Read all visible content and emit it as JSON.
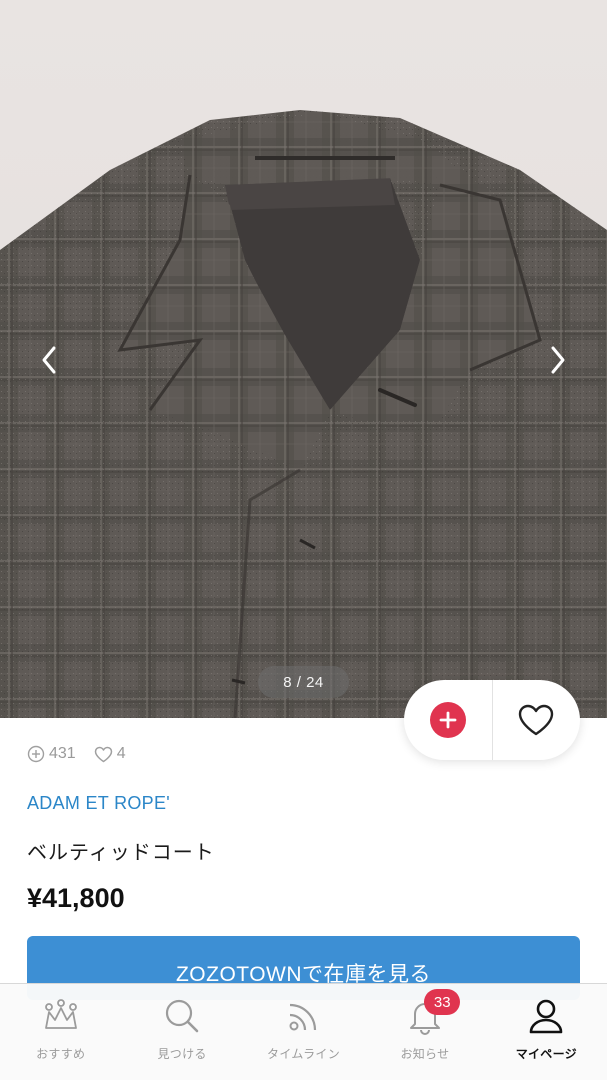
{
  "gallery": {
    "counter": "8 / 24"
  },
  "stats": {
    "add_count": "431",
    "like_count": "4"
  },
  "product": {
    "brand": "ADAM ET ROPE'",
    "name": "ベルティッドコート",
    "price": "¥41,800"
  },
  "stock_button": {
    "label": "ZOZOTOWNで在庫を見る"
  },
  "tabbar": {
    "tabs": [
      {
        "label": "おすすめ",
        "icon": "crown-icon"
      },
      {
        "label": "見つける",
        "icon": "search-icon"
      },
      {
        "label": "タイムライン",
        "icon": "feed-icon"
      },
      {
        "label": "お知らせ",
        "icon": "bell-icon",
        "badge": "33"
      },
      {
        "label": "マイページ",
        "icon": "user-icon",
        "active": true
      }
    ]
  },
  "colors": {
    "accent_red": "#e0344f",
    "brand_blue": "#2b86c8",
    "button_blue": "#3d8fd4"
  }
}
